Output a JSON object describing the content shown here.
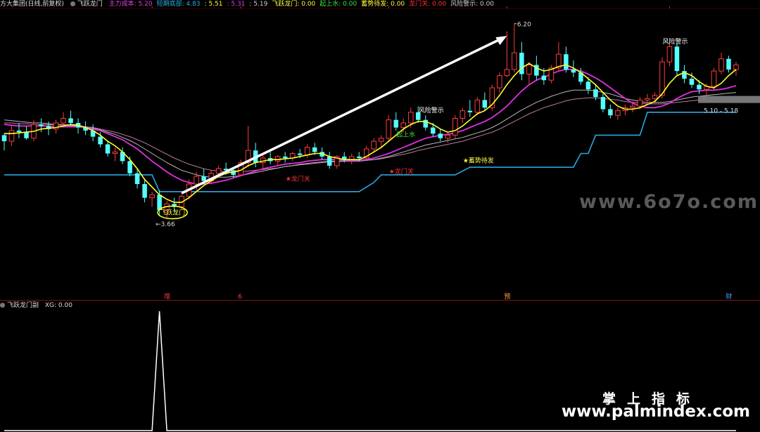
{
  "header": {
    "stock": "方大集团(日线,前复权)",
    "indicator": "飞跃龙门",
    "items": [
      {
        "label": "主力成本: 5.20",
        "color": "#e040e0"
      },
      {
        "label": "短期底部: 4.83",
        "color": "#2ab0e0"
      },
      {
        "label": ": 5.51",
        "color": "#ffff40"
      },
      {
        "label": ": 5.31",
        "color": "#e040e0"
      },
      {
        "label": ": 5.19",
        "color": "#cccccc"
      },
      {
        "label": "飞跃龙门: 0.00",
        "color": "#ffff40"
      },
      {
        "label": "起上水: 0.00",
        "color": "#40e040"
      },
      {
        "label": "蓄势待发: 0.00",
        "color": "#ffff40"
      },
      {
        "label": "龙门关: 0.00",
        "color": "#ff3030"
      },
      {
        "label": "风险警示: 0.00",
        "color": "#cccccc"
      }
    ]
  },
  "sub_header": {
    "title": "飞跃龙门副",
    "value": "XG: 0.00"
  },
  "watermark": {
    "cn": "掌上指标",
    "url": "www.palmindex.com",
    "site": "www.6o7o.com"
  },
  "chart_data": [
    {
      "type": "candlestick",
      "title": "飞跃龙门",
      "ylim": [
        2.6,
        6.4
      ],
      "price_labels": {
        "high": "6.20",
        "low": "3.66",
        "right_range": "5.10 - 5.18"
      },
      "annotations": [
        {
          "text": "飞跃龙门",
          "color": "#ffff40",
          "circled": true
        },
        {
          "text": "龙门关",
          "color": "#ff3030"
        },
        {
          "text": "龙门关",
          "color": "#ff3030"
        },
        {
          "text": "起上水",
          "color": "#40e040"
        },
        {
          "text": "蓄势待发",
          "color": "#ffff40"
        },
        {
          "text": "风险警示",
          "color": "#ffffff"
        },
        {
          "text": "风险警示",
          "color": "#ffffff"
        }
      ],
      "event_markers": [
        {
          "text": "增",
          "color": "#ff4040"
        },
        {
          "text": "6",
          "color": "#ff4040"
        },
        {
          "text": "预",
          "color": "#ffa040"
        },
        {
          "text": "财",
          "color": "#40a0ff"
        }
      ],
      "candles": [
        [
          4.74,
          4.76,
          4.54,
          4.66
        ],
        [
          4.66,
          4.86,
          4.6,
          4.8
        ],
        [
          4.8,
          4.9,
          4.7,
          4.78
        ],
        [
          4.78,
          4.86,
          4.68,
          4.7
        ],
        [
          4.7,
          4.94,
          4.66,
          4.88
        ],
        [
          4.88,
          4.96,
          4.78,
          4.86
        ],
        [
          4.86,
          4.92,
          4.74,
          4.82
        ],
        [
          4.82,
          4.94,
          4.76,
          4.9
        ],
        [
          4.9,
          5.04,
          4.84,
          4.96
        ],
        [
          4.96,
          5.06,
          4.86,
          4.9
        ],
        [
          4.9,
          4.96,
          4.76,
          4.84
        ],
        [
          4.84,
          4.92,
          4.74,
          4.8
        ],
        [
          4.8,
          4.88,
          4.66,
          4.72
        ],
        [
          4.72,
          4.78,
          4.58,
          4.62
        ],
        [
          4.62,
          4.66,
          4.46,
          4.5
        ],
        [
          4.5,
          4.58,
          4.4,
          4.52
        ],
        [
          4.52,
          4.58,
          4.36,
          4.4
        ],
        [
          4.4,
          4.46,
          4.2,
          4.24
        ],
        [
          4.24,
          4.3,
          4.04,
          4.1
        ],
        [
          4.1,
          4.16,
          3.86,
          3.92
        ],
        [
          3.92,
          4.0,
          3.8,
          3.96
        ],
        [
          3.96,
          4.02,
          3.7,
          3.76
        ],
        [
          3.76,
          3.88,
          3.66,
          3.84
        ],
        [
          3.84,
          3.92,
          3.74,
          3.8
        ],
        [
          3.8,
          3.96,
          3.76,
          3.94
        ],
        [
          3.94,
          4.16,
          3.9,
          4.1
        ],
        [
          4.1,
          4.26,
          4.02,
          4.2
        ],
        [
          4.2,
          4.3,
          4.1,
          4.14
        ],
        [
          4.14,
          4.28,
          4.1,
          4.24
        ],
        [
          4.24,
          4.34,
          4.18,
          4.3
        ],
        [
          4.3,
          4.38,
          4.22,
          4.28
        ],
        [
          4.28,
          4.32,
          4.18,
          4.22
        ],
        [
          4.22,
          4.42,
          4.2,
          4.38
        ],
        [
          4.38,
          4.86,
          4.32,
          4.54
        ],
        [
          4.54,
          4.64,
          4.32,
          4.38
        ],
        [
          4.38,
          4.48,
          4.28,
          4.44
        ],
        [
          4.44,
          4.52,
          4.36,
          4.4
        ],
        [
          4.4,
          4.48,
          4.34,
          4.46
        ],
        [
          4.46,
          4.52,
          4.38,
          4.44
        ],
        [
          4.44,
          4.52,
          4.4,
          4.5
        ],
        [
          4.5,
          4.56,
          4.44,
          4.48
        ],
        [
          4.48,
          4.62,
          4.44,
          4.58
        ],
        [
          4.58,
          4.64,
          4.48,
          4.52
        ],
        [
          4.52,
          4.58,
          4.42,
          4.46
        ],
        [
          4.46,
          4.52,
          4.3,
          4.34
        ],
        [
          4.34,
          4.48,
          4.3,
          4.46
        ],
        [
          4.46,
          4.52,
          4.38,
          4.42
        ],
        [
          4.42,
          4.5,
          4.36,
          4.46
        ],
        [
          4.46,
          4.52,
          4.4,
          4.44
        ],
        [
          4.44,
          4.6,
          4.42,
          4.56
        ],
        [
          4.56,
          4.7,
          4.52,
          4.66
        ],
        [
          4.66,
          4.74,
          4.58,
          4.7
        ],
        [
          4.7,
          5.0,
          4.66,
          4.94
        ],
        [
          4.94,
          5.04,
          4.8,
          4.84
        ],
        [
          4.84,
          4.96,
          4.78,
          4.9
        ],
        [
          4.9,
          5.1,
          4.84,
          5.04
        ],
        [
          5.04,
          5.12,
          4.9,
          4.94
        ],
        [
          4.94,
          5.0,
          4.8,
          4.84
        ],
        [
          4.84,
          4.9,
          4.72,
          4.76
        ],
        [
          4.76,
          4.82,
          4.66,
          4.7
        ],
        [
          4.7,
          4.78,
          4.64,
          4.74
        ],
        [
          4.74,
          5.0,
          4.7,
          4.96
        ],
        [
          4.96,
          5.1,
          4.9,
          5.06
        ],
        [
          5.06,
          5.2,
          4.98,
          5.04
        ],
        [
          5.04,
          5.24,
          5.0,
          5.2
        ],
        [
          5.2,
          5.3,
          5.06,
          5.1
        ],
        [
          5.1,
          5.4,
          5.06,
          5.36
        ],
        [
          5.36,
          5.56,
          5.3,
          5.52
        ],
        [
          5.52,
          6.1,
          5.5,
          5.6
        ],
        [
          5.6,
          6.2,
          5.56,
          5.82
        ],
        [
          5.82,
          5.96,
          5.46,
          5.54
        ],
        [
          5.54,
          5.7,
          5.4,
          5.66
        ],
        [
          5.66,
          5.78,
          5.46,
          5.52
        ],
        [
          5.52,
          5.62,
          5.4,
          5.46
        ],
        [
          5.46,
          5.66,
          5.42,
          5.62
        ],
        [
          5.62,
          5.96,
          5.58,
          5.8
        ],
        [
          5.8,
          5.9,
          5.56,
          5.6
        ],
        [
          5.6,
          5.72,
          5.5,
          5.56
        ],
        [
          5.56,
          5.62,
          5.4,
          5.44
        ],
        [
          5.44,
          5.5,
          5.28,
          5.34
        ],
        [
          5.34,
          5.4,
          5.2,
          5.24
        ],
        [
          5.24,
          5.3,
          5.04,
          5.08
        ],
        [
          5.08,
          5.14,
          4.96,
          5.0
        ],
        [
          5.0,
          5.1,
          4.94,
          5.06
        ],
        [
          5.06,
          5.14,
          5.0,
          5.1
        ],
        [
          5.1,
          5.18,
          5.04,
          5.12
        ],
        [
          5.12,
          5.24,
          5.08,
          5.2
        ],
        [
          5.2,
          5.28,
          5.14,
          5.22
        ],
        [
          5.22,
          5.3,
          5.16,
          5.26
        ],
        [
          5.26,
          5.76,
          5.22,
          5.7
        ],
        [
          5.7,
          5.96,
          5.64,
          5.9
        ],
        [
          5.9,
          5.94,
          5.52,
          5.58
        ],
        [
          5.58,
          5.66,
          5.42,
          5.48
        ],
        [
          5.48,
          5.56,
          5.36,
          5.4
        ],
        [
          5.4,
          5.46,
          5.28,
          5.34
        ],
        [
          5.34,
          5.42,
          5.26,
          5.38
        ],
        [
          5.38,
          5.62,
          5.34,
          5.58
        ],
        [
          5.58,
          5.82,
          5.54,
          5.74
        ],
        [
          5.74,
          5.78,
          5.56,
          5.6
        ],
        [
          5.6,
          5.7,
          5.52,
          5.66
        ]
      ],
      "ma_yellow": [
        4.76,
        4.76,
        4.77,
        4.78,
        4.79,
        4.82,
        4.83,
        4.84,
        4.86,
        4.88,
        4.87,
        4.84,
        4.8,
        4.74,
        4.66,
        4.6,
        4.52,
        4.42,
        4.3,
        4.16,
        4.06,
        3.96,
        3.9,
        3.86,
        3.86,
        3.92,
        4.0,
        4.08,
        4.14,
        4.2,
        4.24,
        4.26,
        4.28,
        4.34,
        4.38,
        4.4,
        4.42,
        4.42,
        4.43,
        4.44,
        4.46,
        4.48,
        4.5,
        4.5,
        4.46,
        4.44,
        4.42,
        4.42,
        4.42,
        4.46,
        4.52,
        4.58,
        4.66,
        4.74,
        4.82,
        4.88,
        4.92,
        4.92,
        4.88,
        4.82,
        4.78,
        4.8,
        4.86,
        4.94,
        5.02,
        5.06,
        5.14,
        5.26,
        5.4,
        5.52,
        5.62,
        5.68,
        5.62,
        5.58,
        5.6,
        5.64,
        5.66,
        5.62,
        5.56,
        5.48,
        5.4,
        5.3,
        5.2,
        5.12,
        5.08,
        5.08,
        5.1,
        5.14,
        5.18,
        5.28,
        5.42,
        5.52,
        5.56,
        5.52,
        5.44,
        5.38,
        5.36,
        5.42,
        5.52,
        5.6
      ],
      "ma_magenta": [
        4.88,
        4.87,
        4.86,
        4.86,
        4.86,
        4.86,
        4.86,
        4.85,
        4.85,
        4.85,
        4.85,
        4.84,
        4.82,
        4.8,
        4.76,
        4.72,
        4.68,
        4.62,
        4.56,
        4.48,
        4.4,
        4.33,
        4.26,
        4.2,
        4.15,
        4.12,
        4.1,
        4.1,
        4.11,
        4.13,
        4.15,
        4.18,
        4.21,
        4.24,
        4.27,
        4.3,
        4.32,
        4.34,
        4.36,
        4.37,
        4.38,
        4.4,
        4.41,
        4.42,
        4.42,
        4.42,
        4.41,
        4.41,
        4.41,
        4.42,
        4.44,
        4.47,
        4.5,
        4.54,
        4.58,
        4.62,
        4.66,
        4.7,
        4.72,
        4.74,
        4.75,
        4.77,
        4.8,
        4.84,
        4.88,
        4.92,
        4.97,
        5.04,
        5.12,
        5.22,
        5.32,
        5.4,
        5.46,
        5.5,
        5.54,
        5.58,
        5.6,
        5.6,
        5.58,
        5.54,
        5.49,
        5.43,
        5.36,
        5.29,
        5.22,
        5.16,
        5.12,
        5.1,
        5.1,
        5.12,
        5.16,
        5.22,
        5.27,
        5.31,
        5.32,
        5.33,
        5.33,
        5.34,
        5.36,
        5.39
      ],
      "ma_white": [
        4.94,
        4.93,
        4.92,
        4.91,
        4.9,
        4.9,
        4.89,
        4.88,
        4.88,
        4.87,
        4.86,
        4.85,
        4.83,
        4.81,
        4.78,
        4.75,
        4.71,
        4.67,
        4.62,
        4.56,
        4.5,
        4.44,
        4.38,
        4.33,
        4.28,
        4.25,
        4.22,
        4.2,
        4.19,
        4.19,
        4.19,
        4.2,
        4.21,
        4.23,
        4.25,
        4.27,
        4.29,
        4.31,
        4.33,
        4.34,
        4.36,
        4.37,
        4.38,
        4.39,
        4.4,
        4.4,
        4.4,
        4.4,
        4.4,
        4.41,
        4.42,
        4.44,
        4.46,
        4.49,
        4.52,
        4.55,
        4.58,
        4.61,
        4.63,
        4.65,
        4.67,
        4.69,
        4.71,
        4.74,
        4.77,
        4.8,
        4.84,
        4.89,
        4.95,
        5.01,
        5.07,
        5.12,
        5.17,
        5.21,
        5.25,
        5.28,
        5.31,
        5.33,
        5.33,
        5.33,
        5.32,
        5.3,
        5.28,
        5.25,
        5.22,
        5.2,
        5.18,
        5.17,
        5.17,
        5.17,
        5.18,
        5.2,
        5.22,
        5.24,
        5.25,
        5.26,
        5.27,
        5.28,
        5.29,
        5.3
      ],
      "ma_pink": [
        4.9,
        4.9,
        4.89,
        4.89,
        4.88,
        4.88,
        4.88,
        4.87,
        4.87,
        4.86,
        4.86,
        4.85,
        4.84,
        4.82,
        4.8,
        4.78,
        4.75,
        4.72,
        4.68,
        4.64,
        4.59,
        4.54,
        4.49,
        4.44,
        4.4,
        4.36,
        4.33,
        4.3,
        4.28,
        4.27,
        4.26,
        4.26,
        4.26,
        4.27,
        4.28,
        4.29,
        4.3,
        4.31,
        4.33,
        4.34,
        4.35,
        4.36,
        4.37,
        4.38,
        4.39,
        4.39,
        4.4,
        4.4,
        4.4,
        4.41,
        4.42,
        4.43,
        4.45,
        4.47,
        4.49,
        4.51,
        4.54,
        4.56,
        4.58,
        4.6,
        4.62,
        4.64,
        4.66,
        4.69,
        4.72,
        4.75,
        4.78,
        4.82,
        4.87,
        4.92,
        4.97,
        5.02,
        5.06,
        5.1,
        5.13,
        5.16,
        5.19,
        5.21,
        5.22,
        5.23,
        5.23,
        5.22,
        5.21,
        5.2,
        5.18,
        5.17,
        5.16,
        5.15,
        5.15,
        5.15,
        5.16,
        5.17,
        5.18,
        5.19,
        5.2,
        5.2,
        5.21,
        5.21,
        5.22,
        5.23
      ],
      "support_line": [
        [
          0,
          4.22
        ],
        [
          20,
          4.22
        ],
        [
          21,
          4.0
        ],
        [
          48,
          4.0
        ],
        [
          50,
          4.12
        ],
        [
          51,
          4.22
        ],
        [
          61,
          4.22
        ],
        [
          63,
          4.32
        ],
        [
          77,
          4.32
        ],
        [
          78,
          4.5
        ],
        [
          79,
          4.5
        ],
        [
          80,
          4.74
        ],
        [
          86,
          4.74
        ],
        [
          87,
          5.04
        ],
        [
          94,
          5.04
        ],
        [
          95,
          5.04
        ],
        [
          97,
          5.04
        ],
        [
          99,
          5.04
        ]
      ]
    },
    {
      "type": "line",
      "title": "飞跃龙门副",
      "series": [
        {
          "name": "XG",
          "values": [
            0,
            0,
            0,
            0,
            0,
            0,
            0,
            0,
            0,
            0,
            0,
            0,
            0,
            0,
            0,
            0,
            0,
            0,
            0,
            0,
            0,
            1,
            0,
            0,
            0,
            0,
            0,
            0,
            0,
            0,
            0,
            0,
            0,
            0,
            0,
            0,
            0,
            0,
            0,
            0,
            0,
            0,
            0,
            0,
            0,
            0,
            0,
            0,
            0,
            0,
            0,
            0,
            0,
            0,
            0,
            0,
            0,
            0,
            0,
            0,
            0,
            0,
            0,
            0,
            0,
            0,
            0,
            0,
            0,
            0,
            0,
            0,
            0,
            0,
            0,
            0,
            0,
            0,
            0,
            0,
            0,
            0,
            0,
            0,
            0,
            0,
            0,
            0,
            0,
            0,
            0,
            0,
            0,
            0,
            0,
            0,
            0,
            0,
            0,
            0
          ]
        }
      ],
      "ylim": [
        0,
        1
      ]
    }
  ]
}
